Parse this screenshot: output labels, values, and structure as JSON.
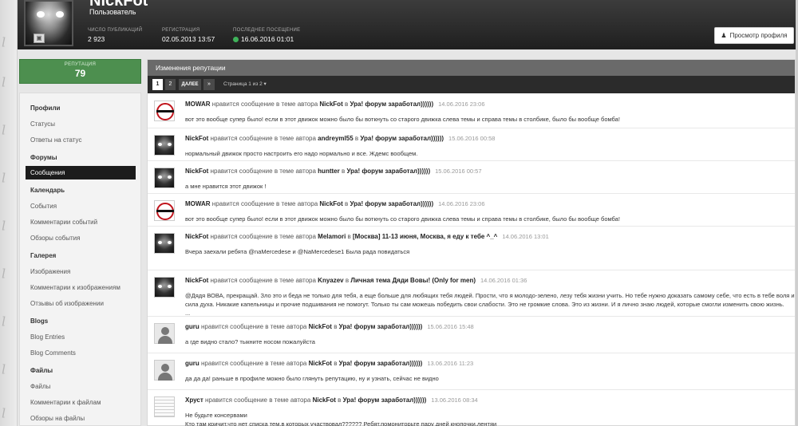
{
  "profile": {
    "name": "NickFot",
    "group": "Пользователь",
    "stats": [
      {
        "label": "Число публикаций",
        "value": "2 923"
      },
      {
        "label": "Регистрация",
        "value": "02.05.2013 13:57"
      },
      {
        "label": "Последнее посещение",
        "value": "16.06.2016 01:01",
        "online": true
      }
    ],
    "view_profile_label": "Просмотр профиля"
  },
  "reputation": {
    "label": "Репутация",
    "value": "79"
  },
  "sidebar": {
    "sections": [
      {
        "title": "Профили",
        "items": [
          "Статусы",
          "Ответы на статус"
        ]
      },
      {
        "title": "Форумы",
        "items": [
          "Сообщения"
        ]
      },
      {
        "title": "Календарь",
        "items": [
          "События",
          "Комментарии событий",
          "Обзоры события"
        ]
      },
      {
        "title": "Галерея",
        "items": [
          "Изображения",
          "Комментарии к изображениям",
          "Отзывы об изображении"
        ]
      },
      {
        "title": "Blogs",
        "items": [
          "Blog Entries",
          "Blog Comments"
        ]
      },
      {
        "title": "Файлы",
        "items": [
          "Файлы",
          "Комментарии к файлам",
          "Обзоры на файлы"
        ]
      }
    ],
    "active_item": "Сообщения"
  },
  "main": {
    "title": "Изменения репутации",
    "pager": {
      "current": "1",
      "next_page": "2",
      "next_label": "ДАЛЕЕ",
      "last_label": "»",
      "page_info": "Страница 1 из 2"
    },
    "entries": [
      {
        "avatar": "ban",
        "user": "MOWAR",
        "action": "нравится сообщение в теме автора",
        "author": "NickFot",
        "prep": "в",
        "topic": "Ура! форум заработал))))))",
        "date": "14.06.2016 23:06",
        "text": [
          "вот это вообще супер было! если в этот движок можно было бы воткнуть со старого движка слева темы и справа темы в столбике, было бы вообще бомба!"
        ]
      },
      {
        "avatar": "car",
        "user": "NickFot",
        "action": "нравится сообщение в теме автора",
        "author": "andreyml55",
        "prep": "в",
        "topic": "Ура! форум заработал))))))",
        "date": "15.06.2016 00:58",
        "text": [
          "нормальный движок просто настроить его надо нормально и все. Ждемс вообщем."
        ]
      },
      {
        "avatar": "car",
        "user": "NickFot",
        "action": "нравится сообщение в теме автора",
        "author": "huntter",
        "prep": "в",
        "topic": "Ура! форум заработал))))))",
        "date": "15.06.2016 00:57",
        "text": [
          "а мне нравится этот движок !"
        ]
      },
      {
        "avatar": "ban",
        "user": "MOWAR",
        "action": "нравится сообщение в теме автора",
        "author": "NickFot",
        "prep": "в",
        "topic": "Ура! форум заработал))))))",
        "date": "14.06.2016 23:06",
        "text": [
          "вот это вообще супер было! если в этот движок можно было бы воткнуть со старого движка слева темы и справа темы в столбике, было бы вообще бомба!"
        ]
      },
      {
        "avatar": "car",
        "user": "NickFot",
        "action": "нравится сообщение в теме автора",
        "author": "Melamori",
        "prep": "в",
        "topic": "[Москва] 11-13 июня, Москва, я еду к тебе ^_^",
        "date": "14.06.2016 13:01",
        "text": [
          "Вчера заехали ребята @naMercedese и @NaMercedese1  Была рада повидаться"
        ]
      },
      {
        "avatar": "car",
        "user": "NickFot",
        "action": "нравится сообщение в теме автора",
        "author": "Knyazev",
        "prep": "в",
        "topic": "Личная тема Дяди Вовы! (Only for men)",
        "date": "14.06.2016 01:36",
        "text": [
          "@Дядя ВОВА, прекращай. Зло это и беда не только для тебя, а еще больше для любящих тебя людей. Прости, что я молодо-зелено, лезу тебя жизни учить. Но тебе нужно доказать самому себе, что есть в тебе воля и",
          "сила духа. Никакие капельницы и прочие подшивания не помогут. Только ты сам можешь победить свои слабости. Это не громкие слова. Это из жизни. И я лично знаю людей, которые смогли изменить свою жизнь.",
          "..."
        ]
      },
      {
        "avatar": "user",
        "user": "guru",
        "action": "нравится сообщение в теме автора",
        "author": "NickFot",
        "prep": "в",
        "topic": "Ура! форум заработал))))))",
        "date": "15.06.2016 15:48",
        "text": [
          "а где видно стало? тыкните носом пожалуйста"
        ]
      },
      {
        "avatar": "user",
        "user": "guru",
        "action": "нравится сообщение в теме автора",
        "author": "NickFot",
        "prep": "в",
        "topic": "Ура! форум заработал))))))",
        "date": "13.06.2016 11:23",
        "text": [
          "да да да! раньше в профиле можно было глянуть репутацию, ну и узнать, сейчас не видно"
        ]
      },
      {
        "avatar": "paper",
        "user": "Хруст",
        "action": "нравится сообщение в теме автора",
        "author": "NickFot",
        "prep": "в",
        "topic": "Ура! форум заработал))))))",
        "date": "13.06.2016 08:34",
        "text": [
          "Не будьте консервами",
          "Кто там кричит,что нет списка тем,в которых участвовал?????? Ребят,помониторьте пару дней кнопочки,лентяи"
        ]
      }
    ]
  }
}
